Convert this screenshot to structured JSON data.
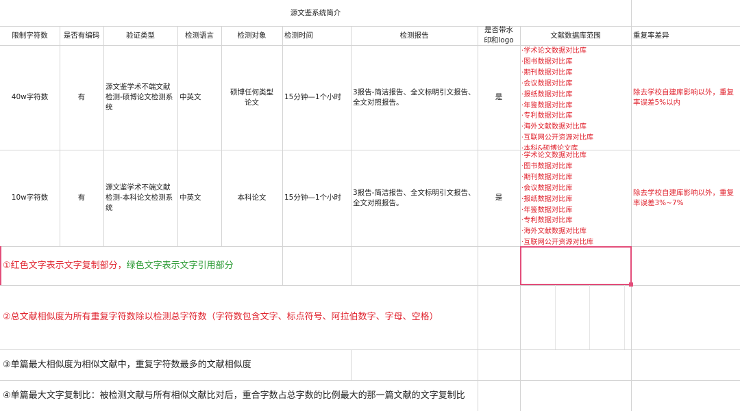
{
  "sheet": {
    "title": "源文鉴系统简介",
    "headers": [
      "限制字符数",
      "是否有编码",
      "验证类型",
      "检测语言",
      "检测对象",
      "检测时间",
      "检测报告",
      "是否带水印和logo",
      "文献数据库范围",
      "重复率差异"
    ],
    "rows": [
      {
        "chars": "40w字符数",
        "encoded": "有",
        "verify_type": "源文鉴学术不端文献检测-硕博论文检测系统",
        "language": "中英文",
        "target": "硕博任何类型论文",
        "time": "15分钟—1个小时",
        "report": "3报告-简洁报告、全文标明引文报告、全文对照报告。",
        "watermark": "是",
        "databases": [
          "·学术论文数据对比库",
          "·图书数据对比库",
          "·期刊数据对比库",
          "·会议数据对比库",
          "·报纸数据对比库",
          "·年鉴数据对比库",
          "·专利数据对比库",
          "·海外文献数据对比库",
          "·互联网公开资源对比库",
          "·本科&硕博论文库"
        ],
        "diff": "除去学校自建库影响以外，重复率误差5%以内"
      },
      {
        "chars": "10w字符数",
        "encoded": "有",
        "verify_type": "源文鉴学术不端文献检测-本科论文检测系统",
        "language": "中英文",
        "target": "本科论文",
        "time": "15分钟—1个小时",
        "report": "3报告-简洁报告、全文标明引文报告、全文对照报告。",
        "watermark": "是",
        "databases": [
          "·学术论文数据对比库",
          "·图书数据对比库",
          "·期刊数据对比库",
          "·会议数据对比库",
          "·报纸数据对比库",
          "·年鉴数据对比库",
          "·专利数据对比库",
          "·海外文献数据对比库",
          "·互联网公开资源对比库"
        ],
        "diff": "除去学校自建库影响以外，重复率误差3%~7%"
      }
    ],
    "notes": {
      "n1_red": "①红色文字表示文字复制部分，",
      "n1_green": "绿色文字表示文字引用部分",
      "n2": "②总文献相似度为所有重复字符数除以检测总字符数（字符数包含文字、标点符号、阿拉伯数字、字母、空格）",
      "n3": "③单篇最大相似度为相似文献中，重复字符数最多的文献相似度",
      "n4": "④单篇最大文字复制比：被检测文献与所有相似文献比对后，重合字数占总字数的比例最大的那一篇文献的文字复制比"
    }
  },
  "colors": {
    "copy_red": "#e0242f",
    "quote_green": "#2a9a33",
    "selection": "#e34d7a",
    "grid": "#d4d4d4"
  }
}
